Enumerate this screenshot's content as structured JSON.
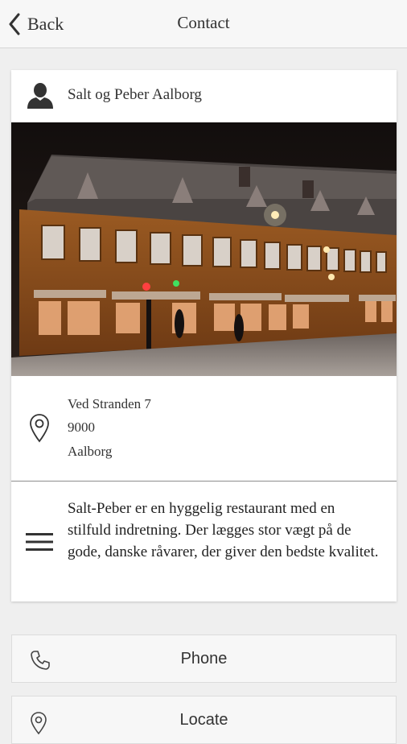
{
  "nav": {
    "back_label": "Back",
    "title": "Contact"
  },
  "contact": {
    "name": "Salt og Peber Aalborg",
    "address": {
      "street": "Ved Stranden 7",
      "zip": "9000",
      "city": "Aalborg"
    },
    "description": "Salt-Peber er en hyggelig restaurant med en stilfuld indretning. Der lægges stor vægt på de gode, danske råvarer, der giver den bedste kvalitet."
  },
  "actions": {
    "phone_label": "Phone",
    "locate_label": "Locate"
  },
  "icons": {
    "back": "chevron-left-icon",
    "person": "person-icon",
    "location": "location-pin-icon",
    "description": "menu-lines-icon",
    "phone": "phone-icon",
    "locate": "location-pin-icon"
  }
}
